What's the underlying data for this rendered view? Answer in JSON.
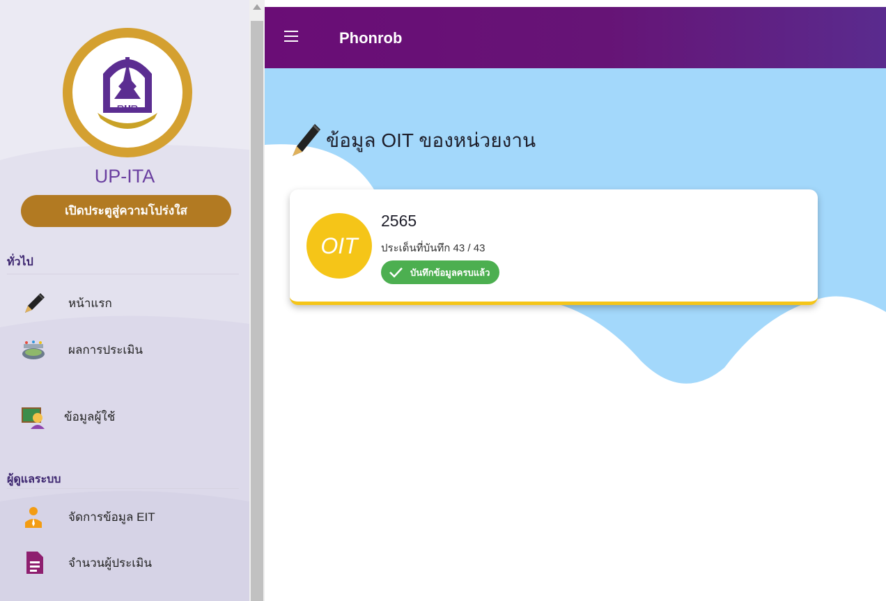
{
  "sidebar": {
    "brand": "UP-ITA",
    "slogan": "เปิดประตูสู่ความโปร่งใส",
    "sections": [
      {
        "label": "ทั่วไป",
        "items": [
          {
            "label": "หน้าแรก",
            "icon": "pen-icon"
          },
          {
            "label": "ผลการประเมิน",
            "icon": "stadium-icon"
          },
          {
            "label": "ข้อมูลผู้ใช้",
            "icon": "teacher-icon"
          }
        ]
      },
      {
        "label": "ผู้ดูแลระบบ",
        "items": [
          {
            "label": "จัดการข้อมูล EIT",
            "icon": "person-tie-icon"
          },
          {
            "label": "จำนวนผู้ประเมิน",
            "icon": "document-icon"
          }
        ]
      }
    ]
  },
  "appbar": {
    "title": "Phonrob",
    "menu_icon": "hamburger-icon"
  },
  "main": {
    "heading": "ข้อมูล OIT ของหน่วยงาน",
    "card": {
      "badge_text": "OIT",
      "year": "2565",
      "subtitle": "ประเด็นที่บันทึก 43 / 43",
      "status": "บันทึกข้อมูลครบแล้ว"
    }
  },
  "colors": {
    "appbar": "#6a0d76",
    "accent_yellow": "#f5c518",
    "status_green": "#4caf50",
    "slogan_bg": "#b27a22",
    "sky": "#a3d8fb"
  }
}
